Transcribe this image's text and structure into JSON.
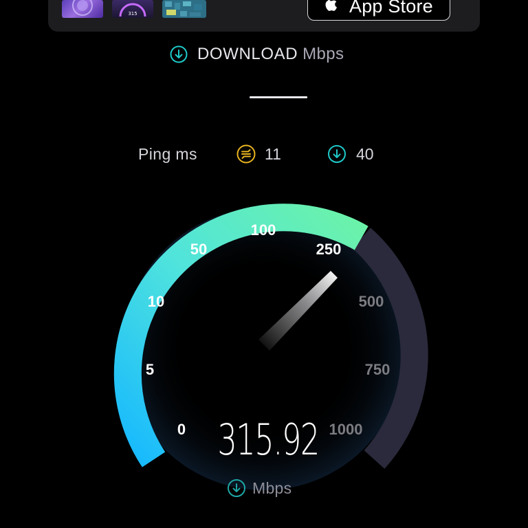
{
  "banner": {
    "app_store_label": "App Store",
    "thumb_2_text": "315",
    "thumbs": [
      "app-screenshot-1",
      "app-screenshot-2",
      "app-screenshot-3"
    ]
  },
  "download": {
    "title": "DOWNLOAD",
    "unit": "Mbps"
  },
  "ping": {
    "label": "Ping ms",
    "jitter_value": "11",
    "download_ping_value": "40"
  },
  "gauge": {
    "scale_labels": [
      "0",
      "5",
      "10",
      "50",
      "100",
      "250",
      "500",
      "750",
      "1000"
    ],
    "current_speed": "315.92",
    "current_speed_numeric": 315.92,
    "unit": "Mbps",
    "colors": {
      "arc_start": "#16b8ff",
      "arc_mid": "#4fe3dd",
      "arc_end": "#6cf3a8",
      "arc_remaining": "#2a2a3c",
      "active_label": "#ffffff",
      "inactive_label": "#7c7c82"
    }
  },
  "icons": {
    "download": "download-arrow-circle-icon",
    "jitter": "jitter-icon",
    "apple": "apple-logo-icon"
  },
  "colors": {
    "background": "#000000",
    "accent_teal": "#1fc9c9",
    "accent_yellow": "#e8b41f"
  }
}
